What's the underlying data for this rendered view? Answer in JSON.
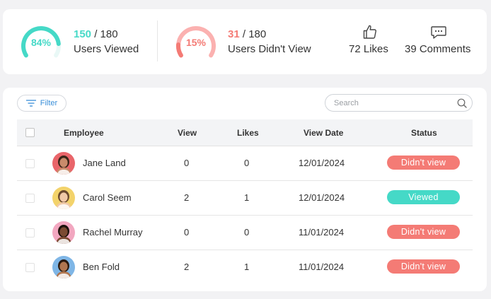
{
  "colors": {
    "teal": "#45d9c7",
    "salmon": "#f47b75",
    "link_blue": "#3a8fd9"
  },
  "stats": {
    "viewed": {
      "percent": "84%",
      "fraction": 0.84,
      "count": "150",
      "total": "/ 180",
      "label": "Users Viewed"
    },
    "not_viewed": {
      "percent": "15%",
      "fraction": 0.15,
      "count": "31",
      "total": "/ 180",
      "label": "Users Didn't View"
    },
    "likes": {
      "icon": "thumbs-up-icon",
      "text": "72  Likes"
    },
    "comments": {
      "icon": "comment-icon",
      "text": "39 Comments"
    }
  },
  "toolbar": {
    "filter_label": "Filter",
    "search_placeholder": "Search"
  },
  "table": {
    "columns": [
      "Employee",
      "View",
      "Likes",
      "View Date",
      "Status"
    ],
    "rows": [
      {
        "name": "Jane Land",
        "view": "0",
        "likes": "0",
        "date": "12/01/2024",
        "status": "Didn't view",
        "status_color": "#f47b75",
        "avatar_bg": "#e9656a",
        "skin": "#c98b6b",
        "hair": "#3a2418"
      },
      {
        "name": "Carol Seem",
        "view": "2",
        "likes": "1",
        "date": "12/01/2024",
        "status": "Viewed",
        "status_color": "#45d9c7",
        "avatar_bg": "#f3d36b",
        "skin": "#f0c9a8",
        "hair": "#6b4a2e"
      },
      {
        "name": "Rachel Murray",
        "view": "0",
        "likes": "0",
        "date": "11/01/2024",
        "status": "Didn't view",
        "status_color": "#f47b75",
        "avatar_bg": "#f2a7c0",
        "skin": "#7b4a32",
        "hair": "#1e120c"
      },
      {
        "name": "Ben Fold",
        "view": "2",
        "likes": "1",
        "date": "11/01/2024",
        "status": "Didn't view",
        "status_color": "#f47b75",
        "avatar_bg": "#7fb6e6",
        "skin": "#b07650",
        "hair": "#2a1a10"
      }
    ]
  }
}
